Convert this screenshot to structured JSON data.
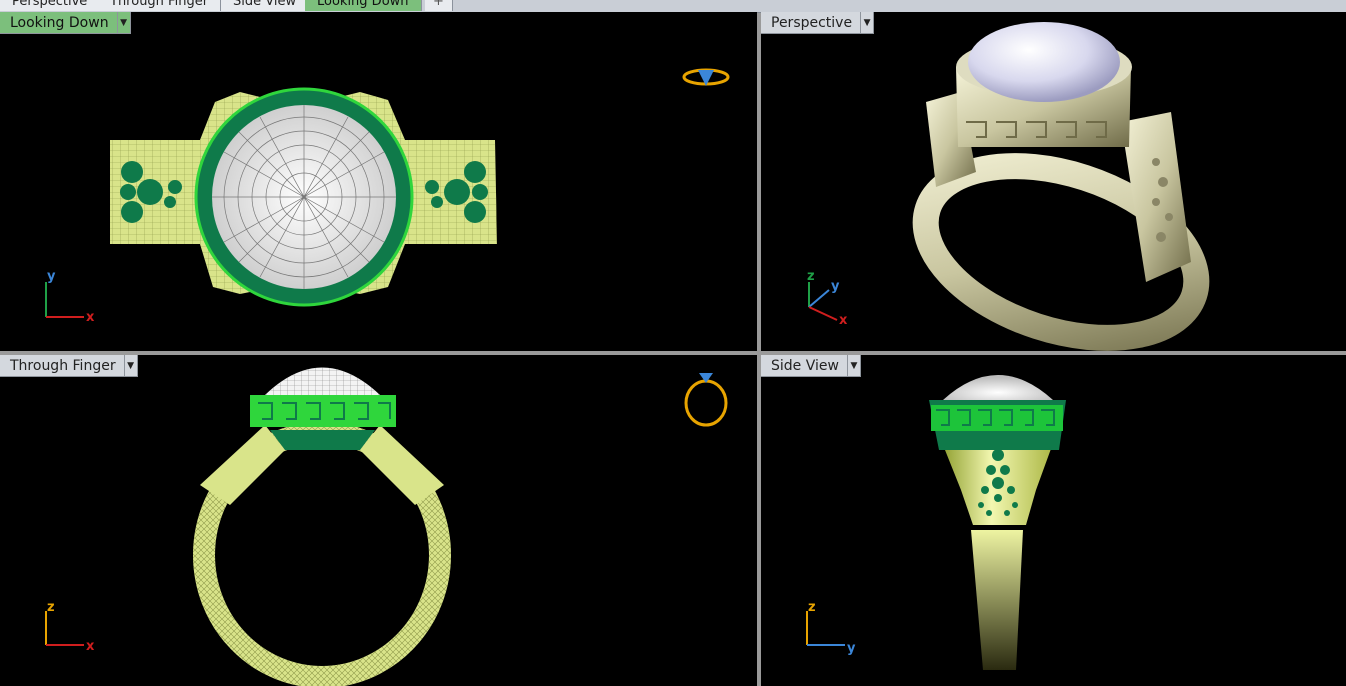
{
  "tabs": [
    {
      "label": "Perspective",
      "active": false
    },
    {
      "label": "Through Finger",
      "active": false
    },
    {
      "label": "Side View",
      "active": false
    },
    {
      "label": "Looking Down",
      "active": true
    },
    {
      "label": "+",
      "active": false
    }
  ],
  "viewports": {
    "top": {
      "label": "Looking Down",
      "active": true,
      "axis_h": "x",
      "axis_v": "y"
    },
    "persp": {
      "label": "Perspective",
      "active": false,
      "axis_x": "x",
      "axis_y": "y",
      "axis_z": "z"
    },
    "front": {
      "label": "Through Finger",
      "active": false,
      "axis_h": "x",
      "axis_v": "z"
    },
    "side": {
      "label": "Side View",
      "active": false,
      "axis_h": "y",
      "axis_v": "z"
    }
  },
  "colors": {
    "viewport_bg": "#000000",
    "gold": "#d9e48a",
    "gem_green": "#0f7a4a",
    "highlight_green": "#2fd63c",
    "axis_red": "#d01e1e",
    "axis_green": "#1fa047",
    "axis_blue": "#3b86d8",
    "gizmo_orange": "#e8a400"
  }
}
